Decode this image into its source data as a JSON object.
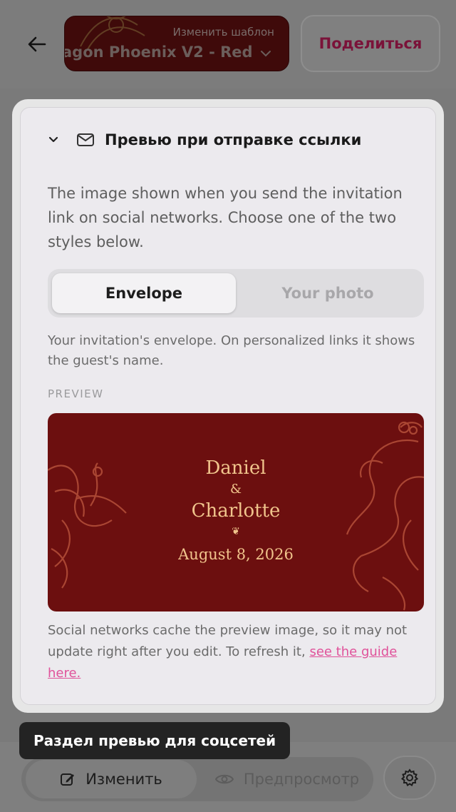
{
  "header": {
    "back_icon": "arrow-left-icon",
    "template_caption": "Изменить шаблон",
    "template_name": "agon Phoenix V2 - Red",
    "share_label": "Поделиться"
  },
  "panel": {
    "title": "Превью при отправке ссылки",
    "description": "The image shown when you send the invitation link on social networks. Choose one of the two styles below.",
    "segments": [
      {
        "label": "Envelope",
        "active": true
      },
      {
        "label": "Your photo",
        "active": false
      }
    ],
    "hint": "Your invitation's envelope. On personalized links it shows the guest's name.",
    "preview_label": "PREVIEW",
    "card": {
      "name1": "Daniel",
      "amp": "&",
      "name2": "Charlotte",
      "ornament": "❦",
      "date": "August 8, 2026"
    },
    "note_text": "Social networks cache the preview image, so it may not update right after you edit. To refresh it, ",
    "note_link": "see the guide here."
  },
  "tooltip": "Раздел превью для соцсетей",
  "bottom": {
    "edit_label": "Изменить",
    "preview_label": "Предпросмотр"
  },
  "colors": {
    "accent": "#e0529a",
    "card_bg": "#6c0f0f",
    "card_text": "#f0c48c"
  }
}
